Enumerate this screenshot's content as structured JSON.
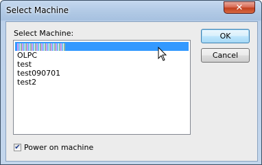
{
  "window": {
    "title": "Select Machine",
    "close_glyph": "✕"
  },
  "dialog": {
    "list_label": "Select Machine:",
    "machines": [
      "OLPC",
      "test",
      "test090701",
      "test2"
    ],
    "ok_label": "OK",
    "cancel_label": "Cancel",
    "power_label": "Power on machine",
    "power_checked": true,
    "check_glyph": "✔"
  },
  "colors": {
    "selection": "#3399ff"
  },
  "icons": {
    "close": "close-icon",
    "cursor": "mouse-pointer-icon"
  }
}
